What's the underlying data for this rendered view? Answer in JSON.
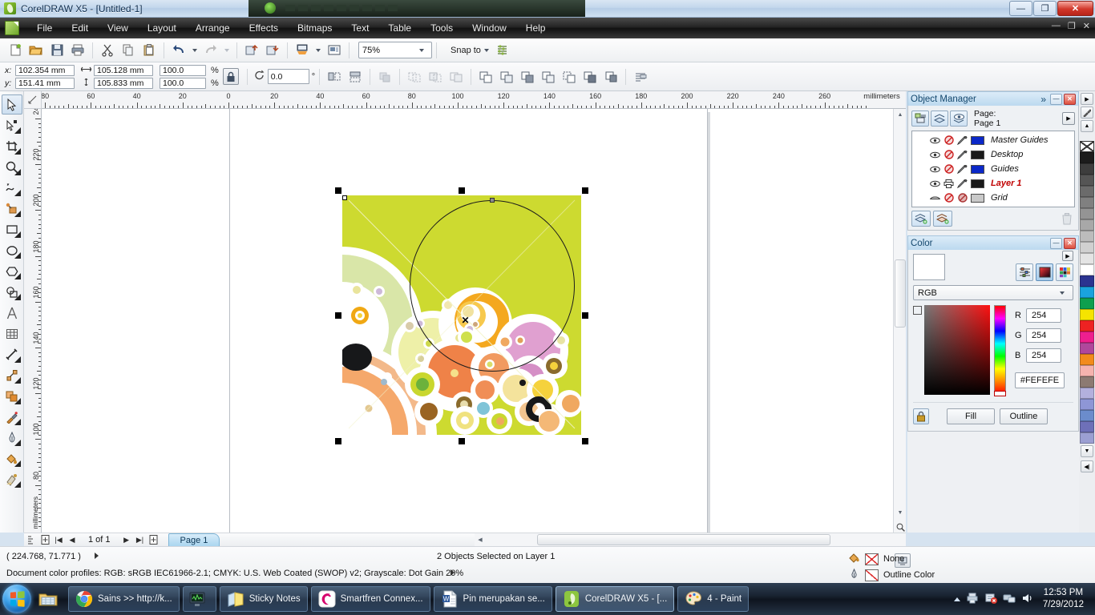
{
  "window": {
    "title": "CorelDRAW X5 - [Untitled-1]",
    "app_icon": "coreldraw-logo-icon",
    "minimize": "—",
    "maximize": "❐",
    "close": "✕",
    "mdi_minimize": "—",
    "mdi_restore": "❐",
    "mdi_close": "✕"
  },
  "menubar": {
    "items": [
      {
        "label": "File"
      },
      {
        "label": "Edit"
      },
      {
        "label": "View"
      },
      {
        "label": "Layout"
      },
      {
        "label": "Arrange"
      },
      {
        "label": "Effects"
      },
      {
        "label": "Bitmaps"
      },
      {
        "label": "Text"
      },
      {
        "label": "Table"
      },
      {
        "label": "Tools"
      },
      {
        "label": "Window"
      },
      {
        "label": "Help"
      }
    ]
  },
  "standard_toolbar": {
    "buttons": [
      "new-icon",
      "open-icon",
      "save-icon",
      "print-icon",
      "cut-icon",
      "copy-icon",
      "paste-icon",
      "undo-icon",
      "redo-icon",
      "import-icon",
      "export-icon",
      "publish-pdf-icon",
      "application-launcher-icon"
    ],
    "zoom_level": "75%",
    "snap_to_label": "Snap to",
    "options_icon": "options-icon"
  },
  "property_bar": {
    "x_label": "x:",
    "y_label": "y:",
    "x_value": "102.354 mm",
    "y_value": "151.41 mm",
    "width_value": "105.128 mm",
    "height_value": "105.833 mm",
    "scale_h": "100.0",
    "scale_v": "100.0",
    "percent_symbol": "%",
    "lock_ratio_icon": "lock-ratio-icon",
    "rotation_value": "0.0",
    "degree_symbol": "°",
    "mirror_h_icon": "mirror-horizontal-icon",
    "mirror_v_icon": "mirror-vertical-icon",
    "to_front_icon": "order-to-front-icon",
    "weld_icon": "weld-icon",
    "trim_icon": "trim-icon",
    "intersect_icon": "intersect-icon",
    "simplify_icon": "simplify-icon",
    "front_minus_back_icon": "front-minus-back-icon",
    "back_minus_front_icon": "back-minus-front-icon",
    "boundary_icon": "create-boundary-icon",
    "wrap_text_icon": "wrap-paragraph-text-icon"
  },
  "toolbox": {
    "tools": [
      {
        "name": "pick-tool-icon",
        "glyph": "pick",
        "active": true,
        "flyout": false
      },
      {
        "name": "shape-tool-icon",
        "glyph": "shape",
        "active": false,
        "flyout": true
      },
      {
        "name": "crop-tool-icon",
        "glyph": "crop",
        "active": false,
        "flyout": true
      },
      {
        "name": "zoom-tool-icon",
        "glyph": "zoom",
        "active": false,
        "flyout": true
      },
      {
        "name": "freehand-tool-icon",
        "glyph": "freehand",
        "active": false,
        "flyout": true
      },
      {
        "name": "smart-fill-tool-icon",
        "glyph": "smartfill",
        "active": false,
        "flyout": true
      },
      {
        "name": "rectangle-tool-icon",
        "glyph": "rect",
        "active": false,
        "flyout": true
      },
      {
        "name": "ellipse-tool-icon",
        "glyph": "ellipse",
        "active": false,
        "flyout": true
      },
      {
        "name": "polygon-tool-icon",
        "glyph": "polygon",
        "active": false,
        "flyout": true
      },
      {
        "name": "basic-shapes-tool-icon",
        "glyph": "shapes",
        "active": false,
        "flyout": true
      },
      {
        "name": "text-tool-icon",
        "glyph": "text",
        "active": false,
        "flyout": false
      },
      {
        "name": "table-tool-icon",
        "glyph": "table",
        "active": false,
        "flyout": false
      },
      {
        "name": "dimension-tool-icon",
        "glyph": "dimension",
        "active": false,
        "flyout": true
      },
      {
        "name": "connector-tool-icon",
        "glyph": "connector",
        "active": false,
        "flyout": true
      },
      {
        "name": "blend-tool-icon",
        "glyph": "blend",
        "active": false,
        "flyout": true
      },
      {
        "name": "color-eyedropper-tool-icon",
        "glyph": "eyedropper",
        "active": false,
        "flyout": true
      },
      {
        "name": "outline-tool-icon",
        "glyph": "outline",
        "active": false,
        "flyout": true
      },
      {
        "name": "fill-tool-icon",
        "glyph": "fill",
        "active": false,
        "flyout": true
      },
      {
        "name": "interactive-fill-tool-icon",
        "glyph": "interactivefill",
        "active": false,
        "flyout": true
      }
    ]
  },
  "rulers": {
    "unit_label": "millimeters",
    "h_labels": [
      "80",
      "60",
      "40",
      "20",
      "0",
      "20",
      "40",
      "60",
      "80",
      "100",
      "120",
      "140",
      "160",
      "180",
      "200",
      "220",
      "240",
      "260"
    ],
    "v_labels": [
      "240",
      "220",
      "200",
      "180",
      "160",
      "140",
      "120",
      "100",
      "80"
    ]
  },
  "canvas": {
    "selection_info": "2 Objects Selected on Layer 1",
    "center_marker": "✕"
  },
  "page_nav": {
    "add_page_before_icon": "add-page-icon",
    "first_icon": "|◀",
    "prev_icon": "◀",
    "counter": "1 of 1",
    "next_icon": "▶",
    "last_icon": "▶|",
    "add_page_after_icon": "add-page-icon",
    "tab_label": "Page 1"
  },
  "status_bar": {
    "coordinates": "( 224.768, 71.771 )",
    "selection": "2 Objects Selected on Layer 1",
    "color_profiles": "Document color profiles: RGB: sRGB IEC61966-2.1; CMYK: U.S. Web Coated (SWOP) v2; Grayscale: Dot Gain 20%",
    "fill_label": "None",
    "outline_label": "Outline Color",
    "fill_icon": "fill-bucket-icon",
    "outline_icon": "outline-pen-icon",
    "snapshot_icon": "screen-capture-icon"
  },
  "object_manager": {
    "title": "Object Manager",
    "expand_icon": "»",
    "minimize_icon": "—",
    "close_icon": "✕",
    "toolbuttons": [
      "show-object-properties-icon",
      "edit-across-layers-icon",
      "layer-manager-view-icon"
    ],
    "page_label": "Page:",
    "page_value": "Page 1",
    "flyout_icon": "▶",
    "layers": [
      {
        "name": "Master Guides",
        "color": "#0b28c8",
        "selected": false,
        "printable": false
      },
      {
        "name": "Desktop",
        "color": "#1a1a1a",
        "selected": false,
        "printable": false
      },
      {
        "name": "Guides",
        "color": "#0b28c8",
        "selected": false,
        "printable": false
      },
      {
        "name": "Layer 1",
        "color": "#1a1a1a",
        "selected": true,
        "printable": true
      },
      {
        "name": "Grid",
        "color": "#c9c9c9",
        "selected": false,
        "printable": false
      }
    ],
    "new_layer_icon": "new-layer-icon",
    "new_master_layer_icon": "new-master-layer-icon",
    "delete_icon": "trash-icon"
  },
  "color_docker": {
    "title": "Color",
    "minimize_icon": "—",
    "close_icon": "✕",
    "flyout_icon": "▶",
    "mode_buttons": [
      "color-sliders-icon",
      "color-viewers-icon",
      "color-palettes-icon"
    ],
    "active_mode": "color-viewers-icon",
    "color_model": "RGB",
    "preview_color": "#FEFEFE",
    "channels": [
      {
        "label": "R",
        "value": "254"
      },
      {
        "label": "G",
        "value": "254"
      },
      {
        "label": "B",
        "value": "254"
      }
    ],
    "hex_value": "#FEFEFE",
    "lock_icon": "lock-icon",
    "fill_button": "Fill",
    "outline_button": "Outline"
  },
  "palette": {
    "scroll_up_icon": "▲",
    "eyedropper_icon": "eyedropper-icon",
    "flyout_icon": "▶",
    "scroll_down_icon": "▼",
    "expand_icon": "◀|",
    "swatches": [
      "none",
      "#1c1c1c",
      "#3d3d3d",
      "#555555",
      "#6b6b6b",
      "#808080",
      "#949494",
      "#a8a8a8",
      "#bcbcbc",
      "#d0d0d0",
      "#e4e4e4",
      "#ffffff",
      "#2b3390",
      "#1aa3dd",
      "#0e9f4e",
      "#f5e400",
      "#ee2222",
      "#ee1f8e",
      "#b0479c",
      "#f28b1c",
      "#f5b3ae",
      "#8c7a72",
      "#b3b0dd",
      "#8e96d6",
      "#6b8ccc",
      "#6e70b8",
      "#9b9fd2"
    ]
  },
  "taskbar": {
    "start_icon": "windows-start-icon",
    "quick_launch": [
      {
        "name": "explorer-icon"
      }
    ],
    "tasks": [
      {
        "label": "Sains >> http://k...",
        "icon": "chrome-icon"
      },
      {
        "label": "",
        "icon": "monitor-icon"
      },
      {
        "label": "Sticky Notes",
        "icon": "sticky-notes-icon"
      },
      {
        "label": "Smartfren Connex...",
        "icon": "smartfren-icon"
      },
      {
        "label": "Pin merupakan se...",
        "icon": "word-icon"
      },
      {
        "label": "CorelDRAW X5 - [...",
        "icon": "coreldraw-icon"
      },
      {
        "label": "4 - Paint",
        "icon": "paint-icon"
      }
    ],
    "tray_icons": [
      "show-hidden-icons-icon",
      "printer-icon",
      "action-center-icon",
      "network-icon",
      "volume-icon"
    ],
    "time": "12:53 PM",
    "date": "7/29/2012"
  }
}
